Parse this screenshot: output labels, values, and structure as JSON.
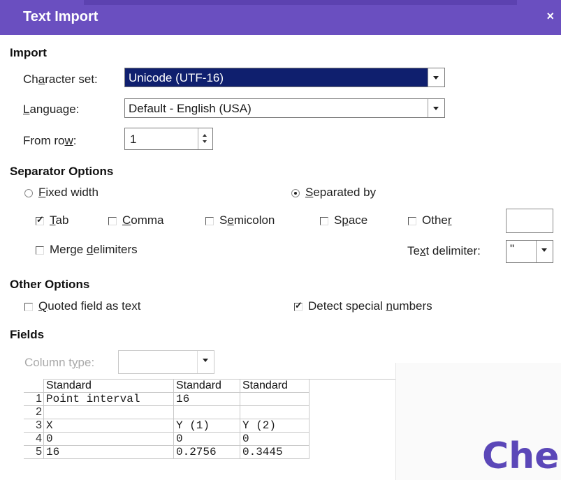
{
  "dialog": {
    "title": "Text Import",
    "close_label": "×"
  },
  "import": {
    "heading": "Import",
    "charset_label": "Character set:",
    "charset_value": "Unicode (UTF-16)",
    "language_label": "Language:",
    "language_value": "Default - English (USA)",
    "fromrow_label": "From row:",
    "fromrow_value": "1"
  },
  "separator": {
    "heading": "Separator Options",
    "fixed_width": "Fixed width",
    "fixed_width_selected": false,
    "separated_by": "Separated by",
    "separated_by_selected": true,
    "tab": "Tab",
    "tab_checked": true,
    "comma": "Comma",
    "comma_checked": false,
    "semicolon": "Semicolon",
    "semicolon_checked": false,
    "space": "Space",
    "space_checked": false,
    "other": "Other",
    "other_checked": false,
    "other_value": "",
    "merge": "Merge delimiters",
    "merge_checked": false,
    "text_delimiter_label": "Text delimiter:",
    "text_delimiter_value": "\""
  },
  "other_options": {
    "heading": "Other Options",
    "quoted": "Quoted field as text",
    "quoted_checked": false,
    "detect": "Detect special numbers",
    "detect_checked": true
  },
  "fields": {
    "heading": "Fields",
    "column_type_label": "Column type:",
    "column_type_value": "",
    "columns": [
      "Standard",
      "Standard",
      "Standard"
    ],
    "rows": [
      {
        "num": "1",
        "cells": [
          "Point interval",
          "16",
          ""
        ]
      },
      {
        "num": "2",
        "cells": [
          "",
          "",
          ""
        ]
      },
      {
        "num": "3",
        "cells": [
          "X",
          "Y (1)",
          "Y (2)"
        ]
      },
      {
        "num": "4",
        "cells": [
          "0",
          "0",
          "0"
        ]
      },
      {
        "num": "5",
        "cells": [
          "16",
          "0.2756",
          "0.3445"
        ]
      }
    ]
  },
  "overlay": {
    "text": "Che"
  },
  "colors": {
    "titlebar": "#6a4fc0",
    "selection": "#0f1f6e",
    "overlay_text": "#5b47b8"
  }
}
